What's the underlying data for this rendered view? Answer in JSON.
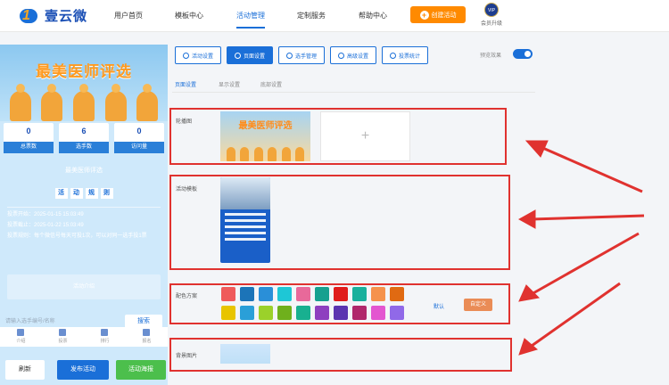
{
  "header": {
    "logo_text": "壹云微",
    "nav": [
      "用户首页",
      "模板中心",
      "活动管理",
      "定制服务",
      "帮助中心"
    ],
    "create_label": "创建活动",
    "vip_badge": "VIP",
    "vip_label": "会员升级"
  },
  "phone": {
    "banner_title": "最美医师评选",
    "stats": [
      {
        "value": "0",
        "label": "总票数"
      },
      {
        "value": "6",
        "label": "选手数"
      },
      {
        "value": "0",
        "label": "访问量"
      }
    ],
    "activity_name": "最美医师评选",
    "rules_chars": [
      "活",
      "动",
      "规",
      "则"
    ],
    "info": [
      "投票开始：2025-01-15 15:03:49",
      "投票截止：2025-01-22 15:03:49",
      "投票规则：每个微信号每天可投1次，可以对同一选手投1票"
    ],
    "vote_area": "活动介绍",
    "search_placeholder": "请输入选手编号/名称",
    "search_btn": "搜索",
    "tabs": [
      "介绍",
      "投票",
      "排行",
      "报名"
    ]
  },
  "actions": {
    "refresh": "刷新",
    "publish": "发布活动",
    "poster": "活动海报"
  },
  "toolbar": {
    "buttons": [
      "活动设置",
      "页面设置",
      "选手管理",
      "高级设置",
      "投票统计"
    ],
    "preview_label": "预览效果"
  },
  "subtabs": [
    "页面设置",
    "显示设置",
    "底部设置"
  ],
  "sections": {
    "carousel_label": "轮播图",
    "carousel_image_title": "最美医师评选",
    "add_icon": "+",
    "template_label": "活动模板",
    "color_label": "配色方案",
    "default_label": "默认",
    "custom_label": "自定义",
    "bg_label": "背景图片"
  },
  "colors": {
    "accent": "#1a6fd8",
    "highlight": "#e0322f",
    "swatches_row1": [
      "#ef5b5b",
      "#1c74b8",
      "#2a8fd8",
      "#1ec7d6",
      "#e8699a",
      "#16a08f",
      "#e01c1c",
      "#19b09c",
      "#f5924d",
      "#e06a12"
    ],
    "swatches_row2": [
      "#e8c400",
      "#2a9fd8",
      "#9bd12a",
      "#6fb01c",
      "#18b090",
      "#8e3fbf",
      "#5b34b0",
      "#b0286b",
      "#e356d0",
      "#9069e8"
    ]
  }
}
